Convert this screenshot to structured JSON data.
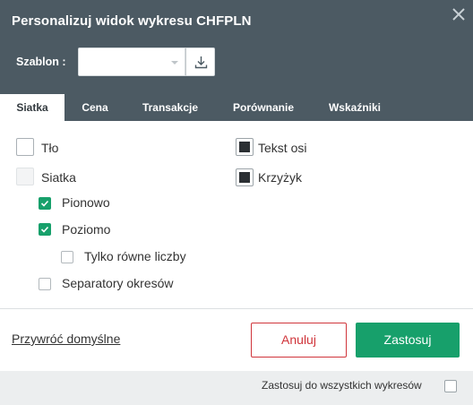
{
  "dialog": {
    "title": "Personalizuj widok wykresu CHFPLN"
  },
  "template": {
    "label": "Szablon :",
    "value": ""
  },
  "tabs": [
    {
      "label": "Siatka",
      "active": true
    },
    {
      "label": "Cena",
      "active": false
    },
    {
      "label": "Transakcje",
      "active": false
    },
    {
      "label": "Porównanie",
      "active": false
    },
    {
      "label": "Wskaźniki",
      "active": false
    }
  ],
  "options": {
    "tlo": {
      "label": "Tło",
      "checked": false
    },
    "siatka": {
      "label": "Siatka",
      "checked": false
    },
    "pionowo": {
      "label": "Pionowo",
      "checked": true
    },
    "poziomo": {
      "label": "Poziomo",
      "checked": true
    },
    "tylko_rowne": {
      "label": "Tylko równe liczby",
      "checked": false
    },
    "separatory": {
      "label": "Separatory okresów",
      "checked": false
    },
    "tekst_osi": {
      "label": "Tekst osi",
      "color": "#2b2f33"
    },
    "krzyzyk": {
      "label": "Krzyżyk",
      "color": "#2b2f33"
    }
  },
  "actions": {
    "reset_label": "Przywróć domyślne",
    "cancel_label": "Anuluj",
    "apply_label": "Zastosuj"
  },
  "footer": {
    "apply_all_label": "Zastosuj do wszystkich wykresów",
    "apply_all_checked": false
  },
  "colors": {
    "header": "#4c5a63",
    "accent_green": "#17a06b",
    "cancel_red": "#d0353b"
  }
}
